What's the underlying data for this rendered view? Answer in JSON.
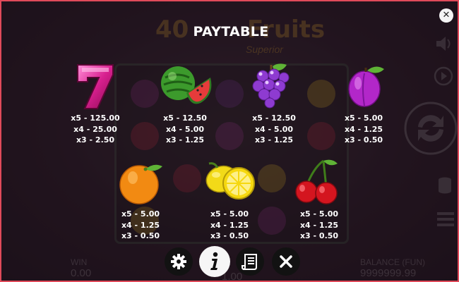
{
  "title": "PAYTABLE",
  "background": {
    "logo_number": "40",
    "logo_word": "Fruits",
    "logo_sub": "Superior",
    "win_label": "WIN",
    "win_value": "0.00",
    "bet_value": "1.00",
    "balance_label": "BALANCE (FUN)",
    "balance_value": "9999999.99"
  },
  "close_icon": "close-icon",
  "symbols": [
    {
      "name": "seven",
      "payouts": [
        "x5 - 125.00",
        "x4 - 25.00",
        "x3 - 2.50"
      ]
    },
    {
      "name": "watermelon",
      "payouts": [
        "x5 - 12.50",
        "x4 - 5.00",
        "x3 - 1.25"
      ]
    },
    {
      "name": "grapes",
      "payouts": [
        "x5 - 12.50",
        "x4 - 5.00",
        "x3 - 1.25"
      ]
    },
    {
      "name": "plum",
      "payouts": [
        "x5 - 5.00",
        "x4 - 1.25",
        "x3 - 0.50"
      ]
    },
    {
      "name": "orange",
      "payouts": [
        "x5 - 5.00",
        "x4 - 1.25",
        "x3 - 0.50"
      ]
    },
    {
      "name": "lemon",
      "payouts": [
        "x5 - 5.00",
        "x4 - 1.25",
        "x3 - 0.50"
      ]
    },
    {
      "name": "cherries",
      "payouts": [
        "x5 - 5.00",
        "x4 - 1.25",
        "x3 - 0.50"
      ]
    }
  ],
  "menu": [
    {
      "icon": "gear-icon",
      "active": false
    },
    {
      "icon": "info-icon",
      "active": true
    },
    {
      "icon": "scroll-rules-icon",
      "active": false
    },
    {
      "icon": "close-icon",
      "active": false
    }
  ],
  "colors": {
    "frame_border": "#e04a5a",
    "text": "#ffffff",
    "menu_button": "#121212",
    "menu_active": "#f6f6f6"
  }
}
